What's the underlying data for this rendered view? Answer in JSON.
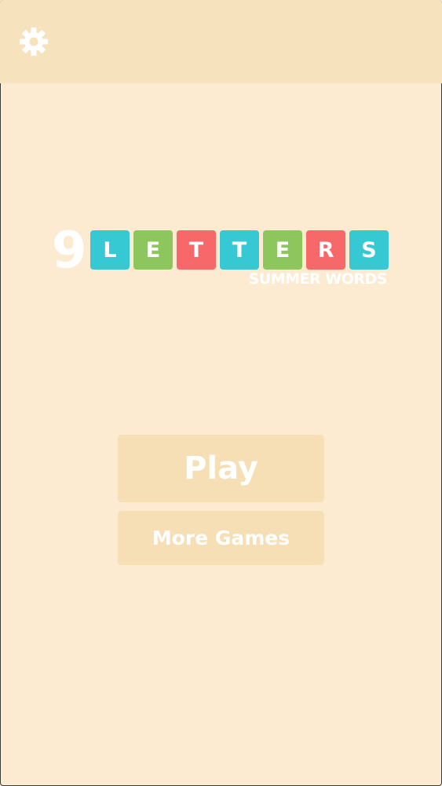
{
  "header": {
    "settings_icon": "gear-icon"
  },
  "logo": {
    "number": "9",
    "tiles": [
      {
        "letter": "L",
        "color": "#37c9d3"
      },
      {
        "letter": "E",
        "color": "#8cc65d"
      },
      {
        "letter": "T",
        "color": "#f7686a"
      },
      {
        "letter": "T",
        "color": "#37c9d3"
      },
      {
        "letter": "E",
        "color": "#8cc65d"
      },
      {
        "letter": "R",
        "color": "#f7686a"
      },
      {
        "letter": "S",
        "color": "#37c9d3"
      }
    ],
    "subtitle": "SUMMER WORDS"
  },
  "menu": {
    "play_label": "Play",
    "more_games_label": "More Games"
  },
  "colors": {
    "background": "#fcebd0",
    "topbar": "#f6e2bc",
    "button": "#f6dfb5",
    "text": "#ffffff"
  }
}
